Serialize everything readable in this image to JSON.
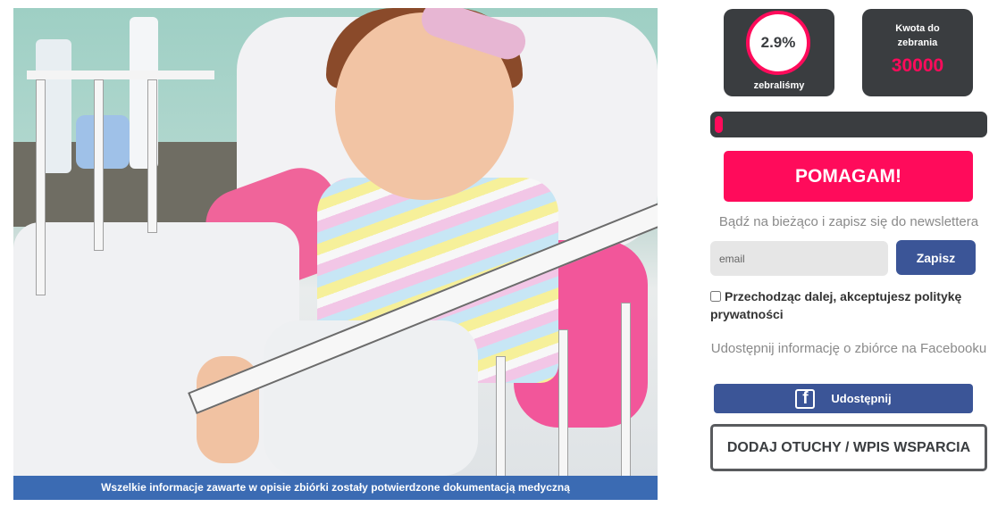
{
  "photo": {
    "caption": "Wszelkie informacje zawarte w opisie zbiórki zostały potwierdzone dokumentacją medyczną"
  },
  "stats": {
    "raised_percent_label": "2.9%",
    "raised_fraction": 0.029,
    "raised_label": "zebraliśmy",
    "goal_label_line1": "Kwota do",
    "goal_label_line2": "zebrania",
    "goal_value": "30000"
  },
  "cta": {
    "help_label": "POMAGAM!"
  },
  "newsletter": {
    "text": "Bądź na bieżąco i zapisz się do newslettera",
    "email_placeholder": "email",
    "subscribe_label": "Zapisz",
    "privacy_text": "Przechodząc dalej, akceptujesz politykę prywatności"
  },
  "share": {
    "text": "Udostępnij informację o zbiórce na Facebooku",
    "facebook_icon": "facebook-icon",
    "facebook_button_label": "Udostępnij",
    "support_button_label": "DODAJ OTUCHY / WPIS WSPARCIA"
  },
  "colors": {
    "accent": "#ff0b5b",
    "dark": "#3a3d40",
    "facebook": "#3b5597",
    "caption_bg": "#3b6bb3"
  }
}
